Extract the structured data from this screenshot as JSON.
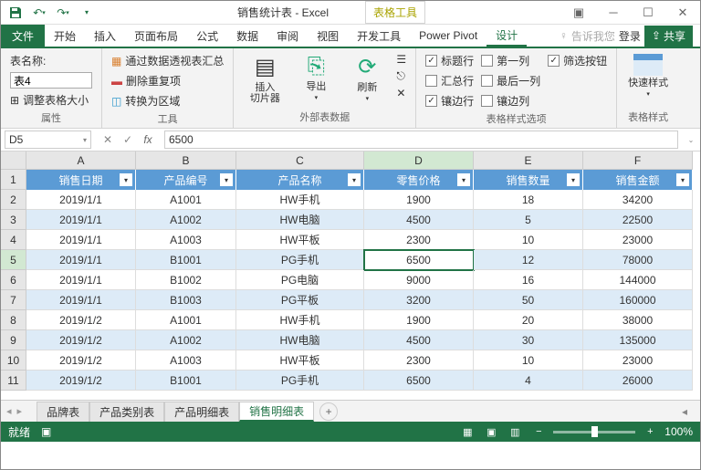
{
  "window": {
    "title": "销售统计表 - Excel",
    "tools_tab": "表格工具"
  },
  "tabs": {
    "file": "文件",
    "home": "开始",
    "insert": "插入",
    "page": "页面布局",
    "formula": "公式",
    "data": "数据",
    "review": "审阅",
    "view": "视图",
    "dev": "开发工具",
    "pivot": "Power Pivot",
    "design": "设计",
    "tell": "告诉我您",
    "login": "登录",
    "share": "共享"
  },
  "ribbon": {
    "props": {
      "label": "属性",
      "tablename_label": "表名称:",
      "tablename_value": "表4",
      "resize": "调整表格大小"
    },
    "tools": {
      "label": "工具",
      "pivot": "通过数据透视表汇总",
      "dedupe": "删除重复项",
      "range": "转换为区域"
    },
    "slicer": {
      "btn1": "插入",
      "btn1b": "切片器",
      "btn2": "导出",
      "btn3": "刷新",
      "label": "外部表数据"
    },
    "styleopt": {
      "label": "表格样式选项",
      "header": "标题行",
      "total": "汇总行",
      "banded": "镶边行",
      "first": "第一列",
      "last": "最后一列",
      "bandedcol": "镶边列",
      "filter": "筛选按钮"
    },
    "styles": {
      "label": "表格样式",
      "quick": "快速样式"
    }
  },
  "namebox": {
    "cell": "D5",
    "formula": "6500"
  },
  "columns": [
    "A",
    "B",
    "C",
    "D",
    "E",
    "F"
  ],
  "headers": [
    "销售日期",
    "产品编号",
    "产品名称",
    "零售价格",
    "销售数量",
    "销售金额"
  ],
  "rows": [
    [
      "2019/1/1",
      "A1001",
      "HW手机",
      "1900",
      "18",
      "34200"
    ],
    [
      "2019/1/1",
      "A1002",
      "HW电脑",
      "4500",
      "5",
      "22500"
    ],
    [
      "2019/1/1",
      "A1003",
      "HW平板",
      "2300",
      "10",
      "23000"
    ],
    [
      "2019/1/1",
      "B1001",
      "PG手机",
      "6500",
      "12",
      "78000"
    ],
    [
      "2019/1/1",
      "B1002",
      "PG电脑",
      "9000",
      "16",
      "144000"
    ],
    [
      "2019/1/1",
      "B1003",
      "PG平板",
      "3200",
      "50",
      "160000"
    ],
    [
      "2019/1/2",
      "A1001",
      "HW手机",
      "1900",
      "20",
      "38000"
    ],
    [
      "2019/1/2",
      "A1002",
      "HW电脑",
      "4500",
      "30",
      "135000"
    ],
    [
      "2019/1/2",
      "A1003",
      "HW平板",
      "2300",
      "10",
      "23000"
    ],
    [
      "2019/1/2",
      "B1001",
      "PG手机",
      "6500",
      "4",
      "26000"
    ]
  ],
  "sheets": {
    "s1": "品牌表",
    "s2": "产品类别表",
    "s3": "产品明细表",
    "s4": "销售明细表"
  },
  "status": {
    "ready": "就绪",
    "zoom": "100%"
  }
}
